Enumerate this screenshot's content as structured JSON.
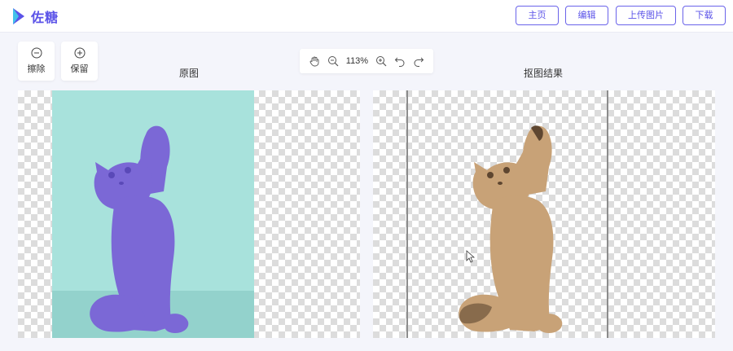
{
  "header": {
    "brand": "佐糖",
    "nav": {
      "home": "主页",
      "edit": "编辑",
      "upload": "上传图片",
      "download": "下载"
    }
  },
  "tools": {
    "erase": {
      "label": "擦除",
      "icon": "minus-circle-icon"
    },
    "keep": {
      "label": "保留",
      "icon": "plus-circle-icon"
    }
  },
  "zoom": {
    "value": "113%",
    "icons": [
      "hand-pan-icon",
      "zoom-out-icon",
      "zoom-in-icon",
      "undo-icon",
      "redo-icon"
    ]
  },
  "panels": {
    "original_title": "原图",
    "result_title": "抠图结果"
  },
  "colors": {
    "brand": "#5b53e8",
    "photo_background": "#a8e2dc",
    "cat_original": "#7b68d6",
    "cat_result": "#c8a277"
  }
}
